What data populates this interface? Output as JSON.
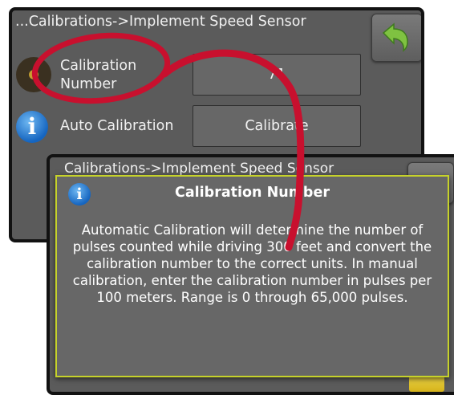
{
  "back_screen": {
    "title": "...Calibrations->Implement Speed Sensor",
    "rows": [
      {
        "label": "Calibration\nNumber",
        "value": "71",
        "icon": "gear-icon"
      },
      {
        "label": "Auto Calibration",
        "value": "Calibrate",
        "icon": "info-icon"
      }
    ],
    "back_icon": "back-arrow-icon"
  },
  "front_screen": {
    "title": "Calibrations->Implement Speed Sensor"
  },
  "dialog": {
    "icon": "info-icon",
    "icon_glyph": "i",
    "title": "Calibration Number",
    "body": "Automatic Calibration will determine the number of pulses counted while driving 300 feet and convert the calibration number to the correct units. In manual calibration, enter the calibration number in pulses per 100 meters. Range is 0 through 65,000 pulses."
  },
  "colors": {
    "screen_bg": "#5b5b5b",
    "dialog_border": "#c6d22a",
    "annotation": "#c8102e",
    "back_arrow": "#7fc241"
  }
}
